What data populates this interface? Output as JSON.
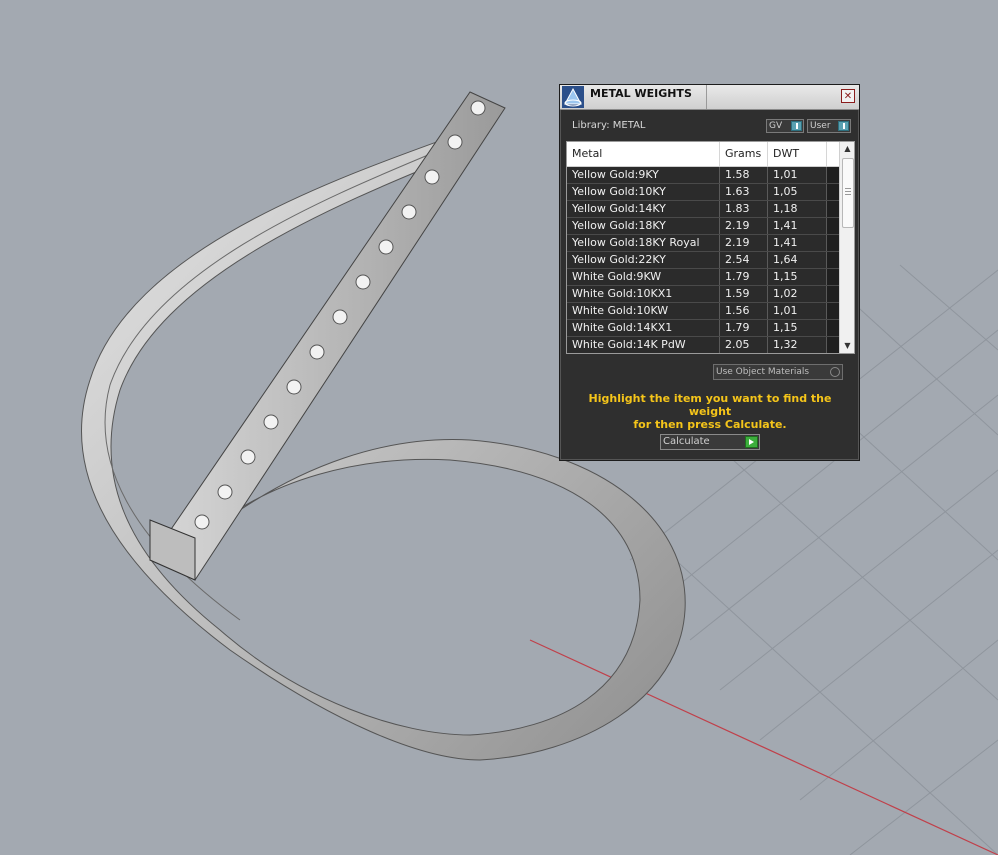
{
  "panel": {
    "title": "METAL WEIGHTS",
    "close_icon": "close-icon",
    "library_label": "Library: METAL",
    "toggles": [
      {
        "label": "GV",
        "state": "on"
      },
      {
        "label": "User",
        "state": "on"
      }
    ],
    "table": {
      "columns": [
        "Metal",
        "Grams",
        "DWT"
      ],
      "rows": [
        {
          "metal": "Yellow Gold:9KY",
          "grams": "1.58",
          "dwt": "1,01"
        },
        {
          "metal": "Yellow Gold:10KY",
          "grams": "1.63",
          "dwt": "1,05"
        },
        {
          "metal": "Yellow Gold:14KY",
          "grams": "1.83",
          "dwt": "1,18"
        },
        {
          "metal": "Yellow Gold:18KY",
          "grams": "2.19",
          "dwt": "1,41"
        },
        {
          "metal": "Yellow Gold:18KY Royal",
          "grams": "2.19",
          "dwt": "1,41"
        },
        {
          "metal": "Yellow Gold:22KY",
          "grams": "2.54",
          "dwt": "1,64"
        },
        {
          "metal": "White Gold:9KW",
          "grams": "1.79",
          "dwt": "1,15"
        },
        {
          "metal": "White Gold:10KX1",
          "grams": "1.59",
          "dwt": "1,02"
        },
        {
          "metal": "White Gold:10KW",
          "grams": "1.56",
          "dwt": "1,01"
        },
        {
          "metal": "White Gold:14KX1",
          "grams": "1.79",
          "dwt": "1,15"
        },
        {
          "metal": "White Gold:14K PdW",
          "grams": "2.05",
          "dwt": "1,32"
        }
      ]
    },
    "use_object_materials": "Use Object Materials",
    "hint_line1": "Highlight the item you want to find the weight",
    "hint_line2": "for then press Calculate.",
    "calculate_label": "Calculate"
  },
  "colors": {
    "viewport_bg": "#a3a9b1",
    "grid": "#8f959d",
    "x_axis": "#c0404a",
    "ring_metal": "#c9c9c9",
    "panel_bg": "#2f2f2f",
    "hint_text": "#f5c51a"
  }
}
